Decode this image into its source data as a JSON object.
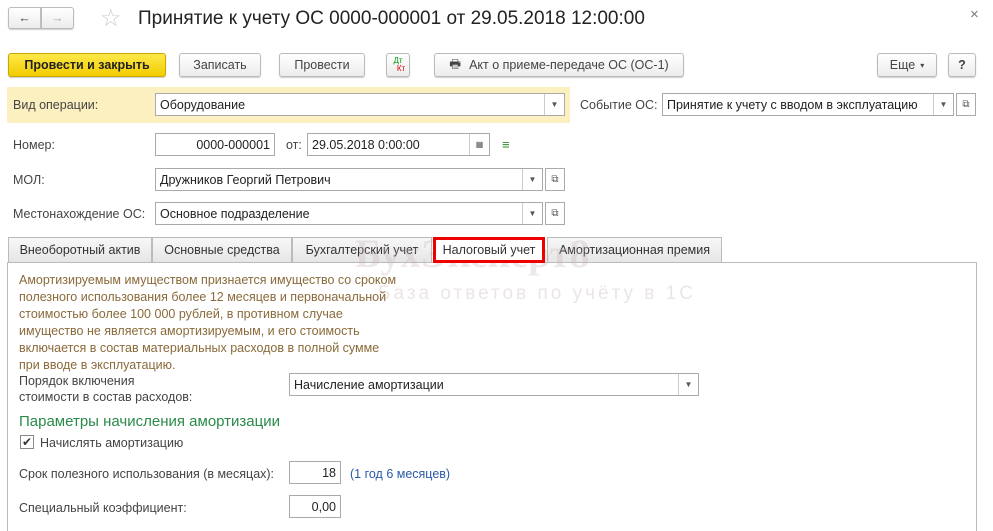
{
  "window": {
    "title": "Принятие к учету ОС 0000-000001 от 29.05.2018 12:00:00"
  },
  "toolbar": {
    "post_close": "Провести и закрыть",
    "save": "Записать",
    "post": "Провести",
    "dtkt_dt": "Дт",
    "dtkt_kt": "Кт",
    "print": "Акт о приеме-передаче ОС (ОС-1)",
    "more": "Еще",
    "help": "?"
  },
  "form": {
    "op_label": "Вид операции:",
    "op_value": "Оборудование",
    "event_label": "Событие ОС:",
    "event_value": "Принятие к учету с вводом в эксплуатацию",
    "num_label": "Номер:",
    "num_value": "0000-000001",
    "from_label": "от:",
    "date_value": "29.05.2018  0:00:00",
    "mol_label": "МОЛ:",
    "mol_value": "Дружников Георгий Петрович",
    "loc_label": "Местонахождение ОС:",
    "loc_value": "Основное подразделение"
  },
  "tabs": [
    {
      "label": "Внеоборотный актив"
    },
    {
      "label": "Основные средства"
    },
    {
      "label": "Бухгалтерский учет"
    },
    {
      "label": "Налоговый учет"
    },
    {
      "label": "Амортизационная премия"
    }
  ],
  "tax": {
    "info": [
      "Амортизируемым имуществом признается имущество со сроком",
      "полезного использования более 12 месяцев и первоначальной",
      "стоимостью более 100 000 рублей, в противном случае",
      "имущество не является амортизируемым, и его стоимость",
      "включается в состав материальных расходов в полной сумме",
      "при вводе в эксплуатацию."
    ],
    "order_label_1": "Порядок включения",
    "order_label_2": "стоимости в состав расходов:",
    "order_value": "Начисление амортизации",
    "section": "Параметры начисления амортизации",
    "accrue_label": "Начислять амортизацию",
    "term_label": "Срок полезного использования (в месяцах):",
    "term_value": "18",
    "term_hint": "(1 год 6 месяцев)",
    "coef_label": "Специальный коэффициент:",
    "coef_value": "0,00"
  },
  "watermark": {
    "brand": "БухЭксперт8",
    "tagline": "База ответов по учёту в 1С"
  }
}
